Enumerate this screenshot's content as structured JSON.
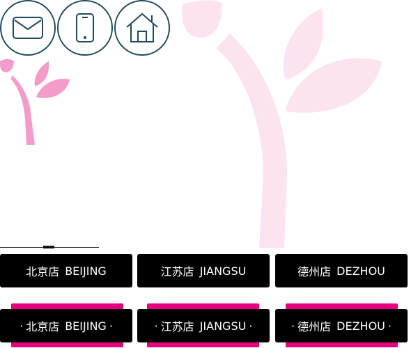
{
  "contact": {
    "icons": [
      "mail-icon",
      "phone-icon",
      "home-icon"
    ]
  },
  "colors": {
    "brand_pink": "#e5007e",
    "logo_pink": "#f39bc9",
    "logo_light_pink": "#fbe3f0",
    "icon_stroke": "#1f4a5e",
    "button_bg": "#000000"
  },
  "stores": {
    "row1": [
      {
        "name_cn": "北京店",
        "name_en": "BEIJING"
      },
      {
        "name_cn": "江苏店",
        "name_en": "JIANGSU"
      },
      {
        "name_cn": "德州店",
        "name_en": "DEZHOU"
      }
    ],
    "row2": [
      {
        "name_cn": "北京店",
        "name_en": "BEIJING",
        "bullet": "·"
      },
      {
        "name_cn": "江苏店",
        "name_en": "JIANGSU",
        "bullet": "·"
      },
      {
        "name_cn": "德州店",
        "name_en": "DEZHOU",
        "bullet": "·"
      }
    ]
  }
}
